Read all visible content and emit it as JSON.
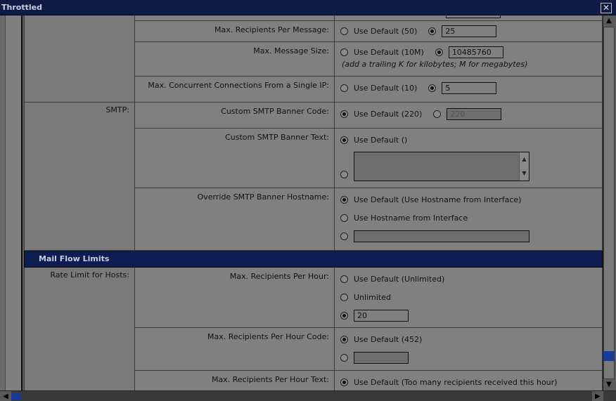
{
  "window": {
    "title": "Throttled",
    "close_symbol": "✕"
  },
  "rows": {
    "max_recipients_per_message": {
      "label": "Max. Recipients Per Message:",
      "default_option": "Use Default (50)",
      "value": "25"
    },
    "max_message_size": {
      "label": "Max. Message Size:",
      "default_option": "Use Default (10M)",
      "value": "10485760",
      "hint": "(add a trailing K for kilobytes; M for megabytes)"
    },
    "max_concurrent_connections": {
      "label": "Max. Concurrent Connections From a Single IP:",
      "default_option": "Use Default (10)",
      "value": "5"
    },
    "smtp_section": "SMTP:",
    "custom_smtp_banner_code": {
      "label": "Custom SMTP Banner Code:",
      "default_option": "Use Default (220)",
      "value": "220"
    },
    "custom_smtp_banner_text": {
      "label": "Custom SMTP Banner Text:",
      "default_option": "Use Default ()",
      "value": ""
    },
    "override_smtp_banner_hostname": {
      "label": "Override SMTP Banner Hostname:",
      "option1": "Use Default (Use Hostname from Interface)",
      "option2": "Use Hostname from Interface",
      "value": ""
    },
    "mail_flow_header": "Mail Flow Limits",
    "rate_limit_section": "Rate Limit for Hosts:",
    "max_recipients_per_hour": {
      "label": "Max. Recipients Per Hour:",
      "option1": "Use Default (Unlimited)",
      "option2": "Unlimited",
      "value": "20"
    },
    "max_recipients_per_hour_code": {
      "label": "Max. Recipients Per Hour Code:",
      "default_option": "Use Default (452)",
      "value": ""
    },
    "max_recipients_per_hour_text": {
      "label": "Max. Recipients Per Hour Text:",
      "default_option": "Use Default (Too many recipients received this hour)"
    }
  },
  "scroll": {
    "up": "▲",
    "down": "▼",
    "left": "◀",
    "right": "▶",
    "textarea_up": "▲",
    "textarea_down": "▼"
  }
}
